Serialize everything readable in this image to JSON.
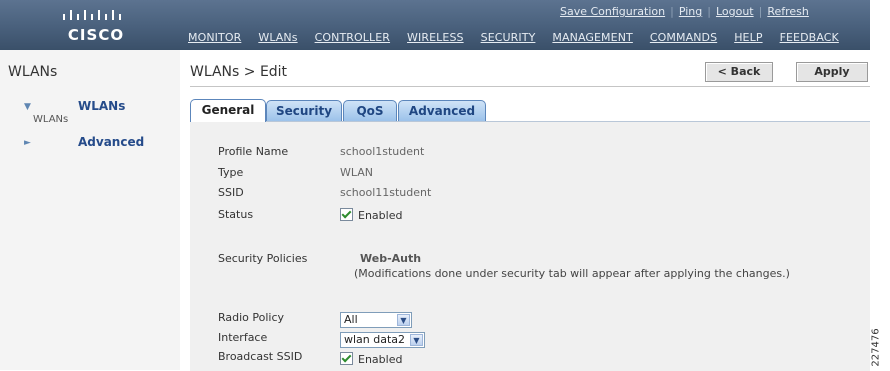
{
  "header": {
    "logo_text": "CISCO",
    "utility_links": [
      {
        "label": "Save Configuration"
      },
      {
        "label": "Ping"
      },
      {
        "label": "Logout"
      },
      {
        "label": "Refresh"
      }
    ],
    "menu": [
      {
        "label": "MONITOR"
      },
      {
        "label": "WLANs"
      },
      {
        "label": "CONTROLLER"
      },
      {
        "label": "WIRELESS"
      },
      {
        "label": "SECURITY"
      },
      {
        "label": "MANAGEMENT"
      },
      {
        "label": "COMMANDS"
      },
      {
        "label": "HELP"
      },
      {
        "label": "FEEDBACK"
      }
    ]
  },
  "sidebar": {
    "title": "WLANs",
    "items": [
      {
        "label": "WLANs",
        "sublabel": "WLANs",
        "expanded": true
      },
      {
        "label": "Advanced",
        "expanded": false
      }
    ]
  },
  "main": {
    "page_title": "WLANs > Edit",
    "buttons": {
      "back": "< Back",
      "apply": "Apply"
    },
    "tabs": [
      {
        "label": "General",
        "active": true
      },
      {
        "label": "Security",
        "active": false
      },
      {
        "label": "QoS",
        "active": false
      },
      {
        "label": "Advanced",
        "active": false
      }
    ],
    "fields": {
      "profile_name": {
        "label": "Profile Name",
        "value": "school1student"
      },
      "type": {
        "label": "Type",
        "value": "WLAN"
      },
      "ssid": {
        "label": "SSID",
        "value": "school11student"
      },
      "status": {
        "label": "Status",
        "checkbox_label": "Enabled",
        "checked": true
      },
      "security_policies": {
        "label": "Security Policies",
        "value": "Web-Auth",
        "note": "(Modifications done under security tab will appear after applying the changes.)"
      },
      "radio_policy": {
        "label": "Radio Policy",
        "selected": "All"
      },
      "interface": {
        "label": "Interface",
        "selected": "wlan data2"
      },
      "broadcast_ssid": {
        "label": "Broadcast SSID",
        "checkbox_label": "Enabled",
        "checked": true
      }
    }
  },
  "figure_id": "227476",
  "colors": {
    "header_bg": "#49607c",
    "sidebar_bg": "#f4f4f4",
    "panel_bg": "#f0f0f0",
    "tab_inactive_bg": "#9cc2ea",
    "sidebar_link": "#254b8a",
    "checkbox_check": "#2e8c2e"
  }
}
